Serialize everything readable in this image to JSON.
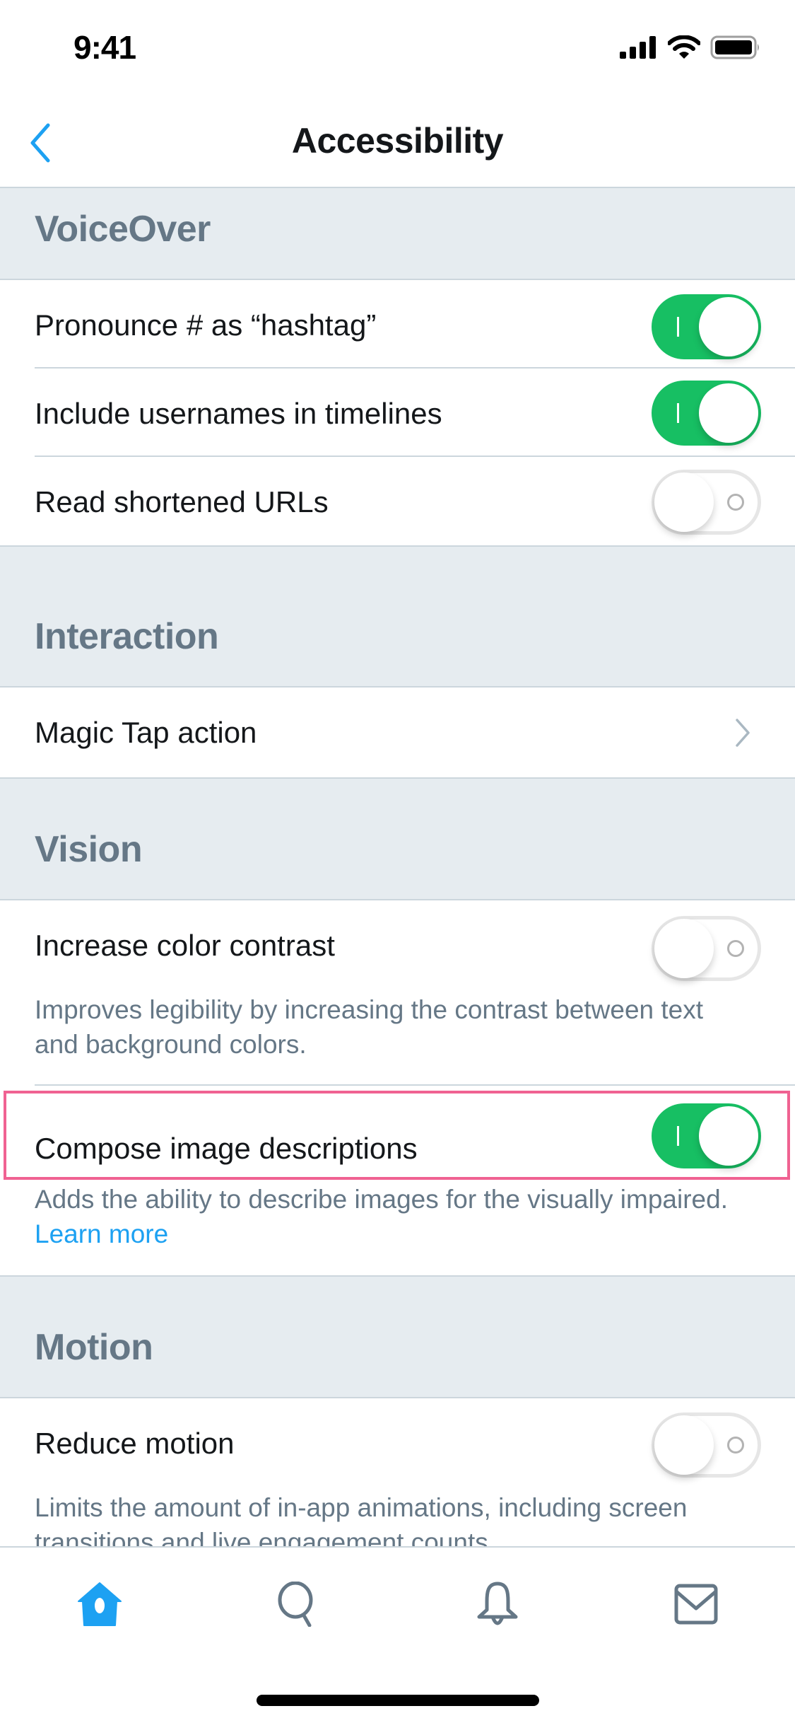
{
  "status_bar": {
    "time": "9:41",
    "icons": [
      "cellular-signal-icon",
      "wifi-icon",
      "battery-icon"
    ]
  },
  "nav": {
    "title": "Accessibility",
    "back_icon": "chevron-left-icon"
  },
  "colors": {
    "accent": "#1da1f2",
    "toggle_on": "#17bf63",
    "section_bg": "#e6ecf0",
    "section_text": "#657786",
    "highlight": "#f06292"
  },
  "sections": [
    {
      "title": "VoiceOver",
      "rows": [
        {
          "label": "Pronounce # as “hashtag”",
          "type": "toggle",
          "on": true
        },
        {
          "label": "Include usernames in timelines",
          "type": "toggle",
          "on": true
        },
        {
          "label": "Read shortened URLs",
          "type": "toggle",
          "on": false
        }
      ]
    },
    {
      "title": "Interaction",
      "rows": [
        {
          "label": "Magic Tap action",
          "type": "disclosure",
          "icon": "chevron-right-icon"
        }
      ]
    },
    {
      "title": "Vision",
      "rows": [
        {
          "label": "Increase color contrast",
          "type": "toggle",
          "on": false,
          "description": "Improves legibility by increasing the contrast between text and background colors."
        },
        {
          "label": "Compose image descriptions",
          "type": "toggle",
          "on": true,
          "highlighted": true,
          "description": "Adds the ability to describe images for the visually impaired.",
          "link": "Learn more"
        }
      ]
    },
    {
      "title": "Motion",
      "rows": [
        {
          "label": "Reduce motion",
          "type": "toggle",
          "on": false,
          "description": "Limits the amount of in-app animations, including screen transitions and live engagement counts."
        }
      ]
    }
  ],
  "tab_bar": {
    "tabs": [
      {
        "name": "home",
        "icon": "home-icon",
        "active": true
      },
      {
        "name": "search",
        "icon": "search-icon",
        "active": false
      },
      {
        "name": "notifications",
        "icon": "bell-icon",
        "active": false
      },
      {
        "name": "messages",
        "icon": "mail-icon",
        "active": false
      }
    ]
  }
}
